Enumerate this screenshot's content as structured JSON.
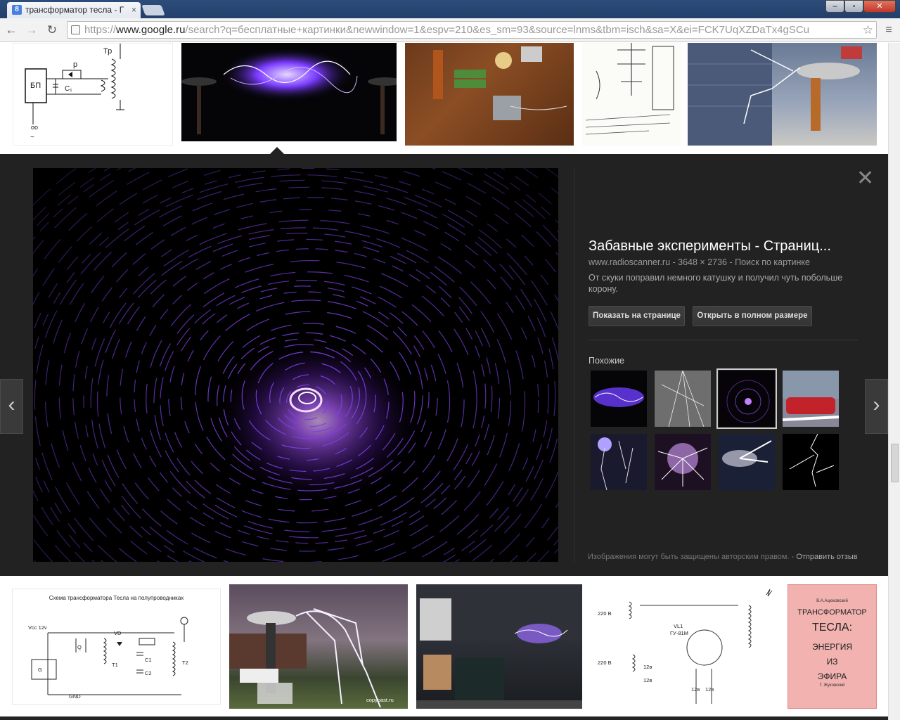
{
  "browser": {
    "tab_title": "трансформатор тесла - Г",
    "tab_favicon": "8",
    "tab_close": "×",
    "window_minimize": "–",
    "window_maximize": "▫",
    "window_close": "✕",
    "url_scheme": "https://",
    "url_host": "www.google.ru",
    "url_path": "/search?q=бесплатные+картинки&newwindow=1&espv=210&es_sm=93&source=lnms&tbm=isch&sa=X&ei=FCK7UqXZDaTx4gSCu",
    "back_icon": "back-arrow-icon",
    "forward_icon": "forward-arrow-icon",
    "reload_icon": "reload-icon",
    "star_icon": "star-icon",
    "menu_icon": "menu-icon"
  },
  "top_results": {
    "schematic_labels": {
      "tr": "Тр",
      "p": "р",
      "psu": "БП",
      "c1": "C₁",
      "ac": "~"
    }
  },
  "preview": {
    "title": "Забавные эксперименты - Страниц...",
    "site": "www.radioscanner.ru",
    "dimensions": "3648 × 2736",
    "search_by_image": "Поиск по картинке",
    "meta_separator": " - ",
    "description": "От скуки поправил немного катушку и получил чуть побольше корону.",
    "show_on_page_label": "Показать на странице",
    "open_full_size_label": "Открыть в полном размере",
    "similar_label": "Похожие",
    "copyright_text": "Изображения могут быть защищены авторским правом.",
    "copyright_separator": " - ",
    "feedback_label": "Отправить отзыв",
    "close_icon": "✕",
    "prev_icon": "‹",
    "next_icon": "›"
  },
  "bottom_results": {
    "schematic_title": "Схема трансформатора Тесла на полупроводниках",
    "schematic_labels": {
      "vcc": "Vcc 12v",
      "vd": "VD",
      "q": "Q",
      "g": "G",
      "t1": "T1",
      "c1": "C1",
      "c2": "C2",
      "t2": "T2",
      "gnd": "GND"
    },
    "tube_labels": {
      "v1": "220 В",
      "v2": "220 В",
      "vl": "VL1",
      "tube": "ГУ-81М",
      "v12a": "12в",
      "v12b": "12в",
      "v12c": "12в",
      "v12d": "12в"
    },
    "book": {
      "author": "В.А.Ацюковский",
      "line1": "ТРАНСФОРМАТОР",
      "line2": "ТЕСЛА:",
      "line3": "ЭНЕРГИЯ",
      "line4": "ИЗ",
      "line5": "ЭФИРА",
      "footer": "Г. Жуковский"
    },
    "watermark": "copypast.ru"
  },
  "colors": {
    "panel": "#222222",
    "plasma": "#8a4dff",
    "accent_link": "#aaaaaa"
  }
}
